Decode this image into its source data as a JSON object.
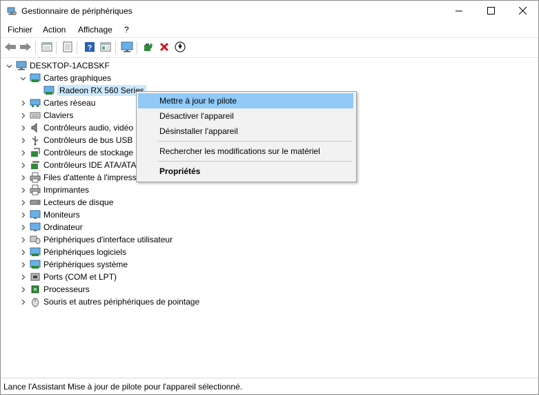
{
  "window": {
    "title": "Gestionnaire de périphériques",
    "controls": [
      "minimize-icon",
      "maximize-icon",
      "close-icon"
    ]
  },
  "menu": [
    "Fichier",
    "Action",
    "Affichage",
    "?"
  ],
  "toolbar": {
    "icons": [
      "back-arrow-icon",
      "forward-arrow-icon",
      "properties-icon",
      "list-icon",
      "help-icon",
      "view-icon",
      "monitor-icon",
      "update-driver-icon",
      "uninstall-icon",
      "download-icon"
    ]
  },
  "tree": {
    "root": "DESKTOP-1ACBSKF",
    "categories": [
      {
        "label": "Cartes graphiques",
        "expanded": true,
        "icon": "display-adapter-icon"
      },
      {
        "label": "Cartes réseau",
        "icon": "network-adapter-icon"
      },
      {
        "label": "Claviers",
        "icon": "keyboard-icon"
      },
      {
        "label": "Contrôleurs audio, vidéo",
        "icon": "audio-icon"
      },
      {
        "label": "Contrôleurs de bus USB",
        "icon": "usb-icon"
      },
      {
        "label": "Contrôleurs de stockage",
        "icon": "storage-icon"
      },
      {
        "label": "Contrôleurs IDE ATA/ATA",
        "icon": "ide-icon"
      },
      {
        "label": "Files d'attente à l'impress",
        "icon": "print-queue-icon"
      },
      {
        "label": "Imprimantes",
        "icon": "printer-icon"
      },
      {
        "label": "Lecteurs de disque",
        "icon": "disk-drive-icon"
      },
      {
        "label": "Moniteurs",
        "icon": "monitor-icon"
      },
      {
        "label": "Ordinateur",
        "icon": "computer-icon"
      },
      {
        "label": "Périphériques d'interface utilisateur",
        "icon": "hid-icon"
      },
      {
        "label": "Périphériques logiciels",
        "icon": "software-device-icon"
      },
      {
        "label": "Périphériques système",
        "icon": "system-device-icon"
      },
      {
        "label": "Ports (COM et LPT)",
        "icon": "port-icon"
      },
      {
        "label": "Processeurs",
        "icon": "processor-icon"
      },
      {
        "label": "Souris et autres périphériques de pointage",
        "icon": "mouse-icon"
      }
    ],
    "selected_device": "Radeon RX 560 Series"
  },
  "context_menu": {
    "items": [
      "Mettre à jour le pilote",
      "Désactiver l'appareil",
      "Désinstaller l'appareil",
      "Rechercher les modifications sur le matériel",
      "Propriétés"
    ],
    "highlighted_index": 0,
    "highlight_color": "#91c9f7"
  },
  "status_bar": {
    "text": "Lance l'Assistant Mise à jour de pilote pour l'appareil sélectionné."
  },
  "colors": {
    "selection": "#cce8ff",
    "menu_bg": "#f2f2f2",
    "delete_red": "#d9141b"
  }
}
